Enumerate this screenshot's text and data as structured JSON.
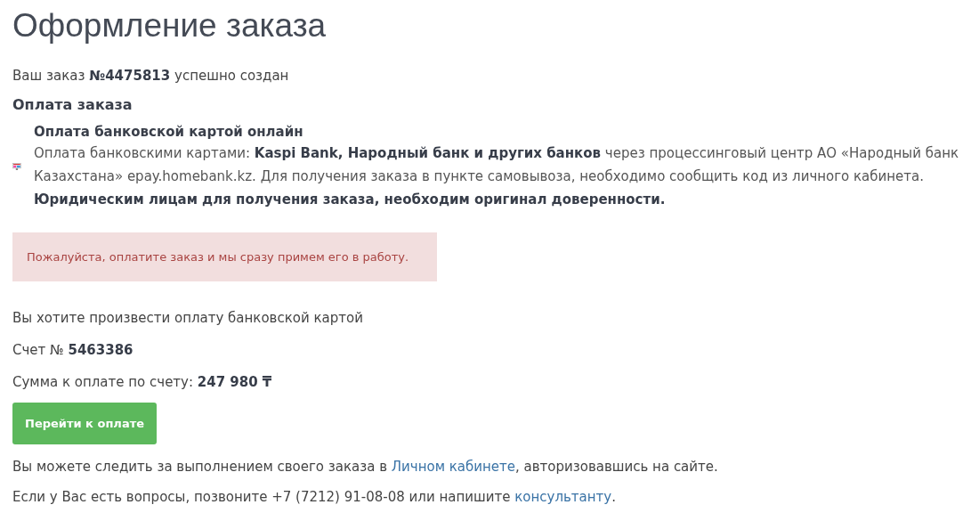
{
  "title": "Оформление заказа",
  "order_created": "Ваш заказ **№4475813** успешно создан",
  "payment_heading": "Оплата заказа",
  "payment_method": {
    "name": "Оплата банковской картой онлайн",
    "description": "Оплата банковскими картами: **Kaspi Bank, Народный банк и других банков** через процессинговый центр АО «Народный банк Казахстана» epay.homebank.kz. Для получения заказа в пункте самовывоза, необходимо сообщить код из личного кабинета. **Юридическим лицам для получения заказа, необходим оригинал доверенности.**"
  },
  "alert": "Пожалуйста, оплатите заказ и мы сразу примем его в работу.",
  "intent": "Вы хотите произвести оплату банковской картой",
  "invoice": "Счет № **5463386**",
  "amount": "Сумма к оплате по счету: **247 980 ₸**",
  "pay_button": "Перейти к оплате",
  "track_note": {
    "before": "Вы можете следить за выполнением своего заказа в ",
    "link": "Личном кабинете",
    "after": ", авторизовавшись на сайте."
  },
  "contact_note": {
    "before": "Если у Вас есть вопросы, позвоните +7 (7212) 91-08-08 или напишите ",
    "link": "консультанту",
    "after": "."
  }
}
